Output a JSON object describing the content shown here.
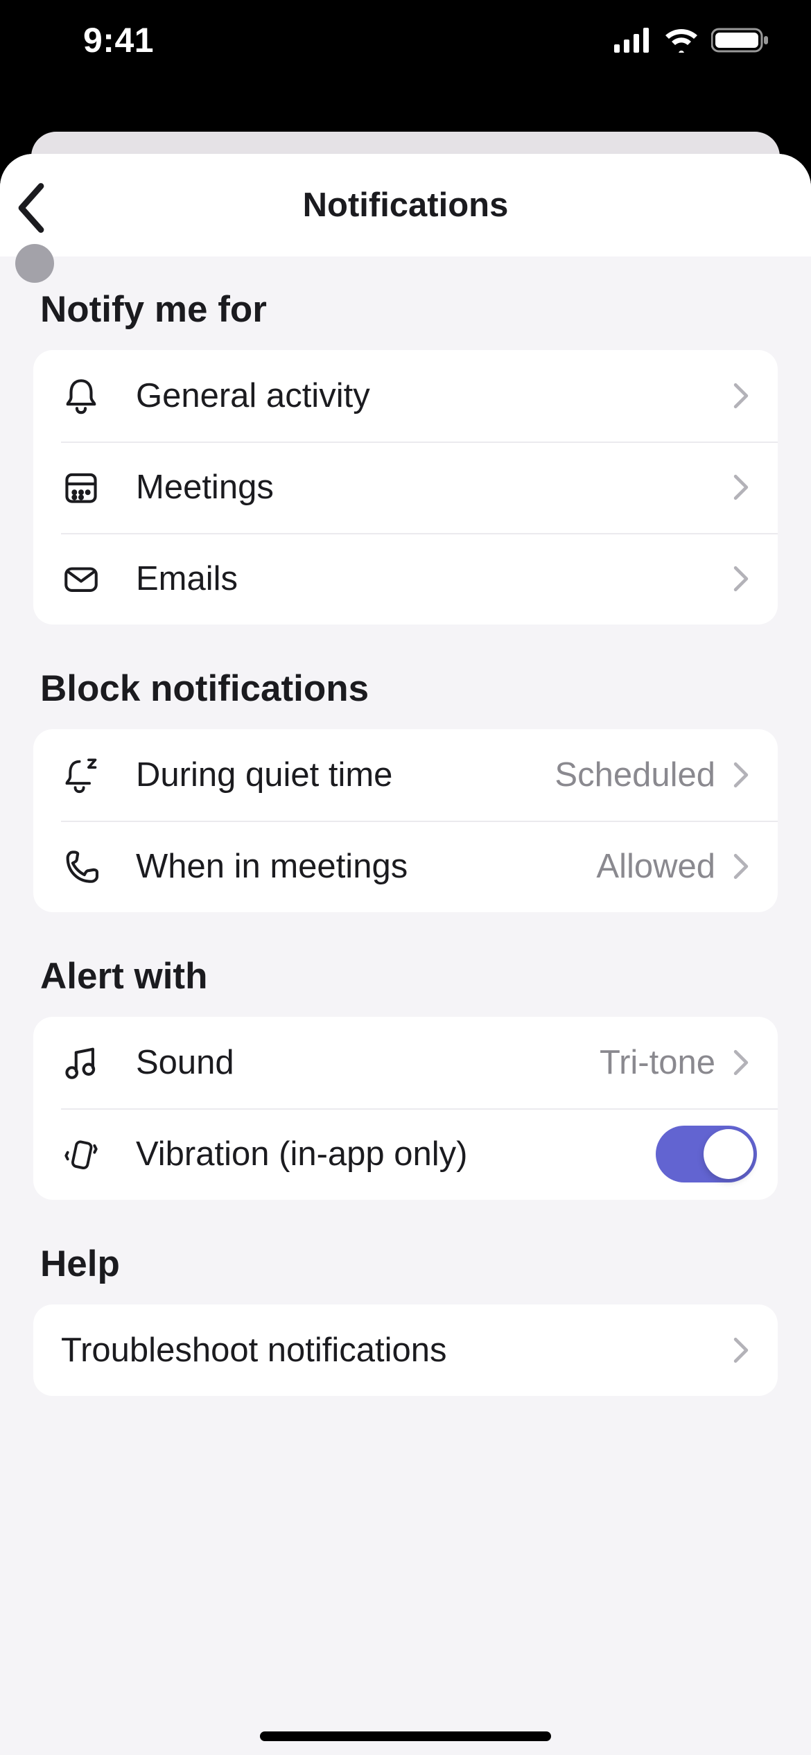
{
  "status": {
    "time": "9:41"
  },
  "nav": {
    "title": "Notifications"
  },
  "sections": {
    "notify_me_for": {
      "title": "Notify me for",
      "general_activity": "General activity",
      "meetings": "Meetings",
      "emails": "Emails"
    },
    "block": {
      "title": "Block notifications",
      "quiet_time_label": "During quiet time",
      "quiet_time_value": "Scheduled",
      "meetings_label": "When in meetings",
      "meetings_value": "Allowed"
    },
    "alert": {
      "title": "Alert with",
      "sound_label": "Sound",
      "sound_value": "Tri-tone",
      "vibration_label": "Vibration (in-app only)",
      "vibration_on": true
    },
    "help": {
      "title": "Help",
      "troubleshoot": "Troubleshoot notifications"
    }
  },
  "accent": "#6264d1"
}
